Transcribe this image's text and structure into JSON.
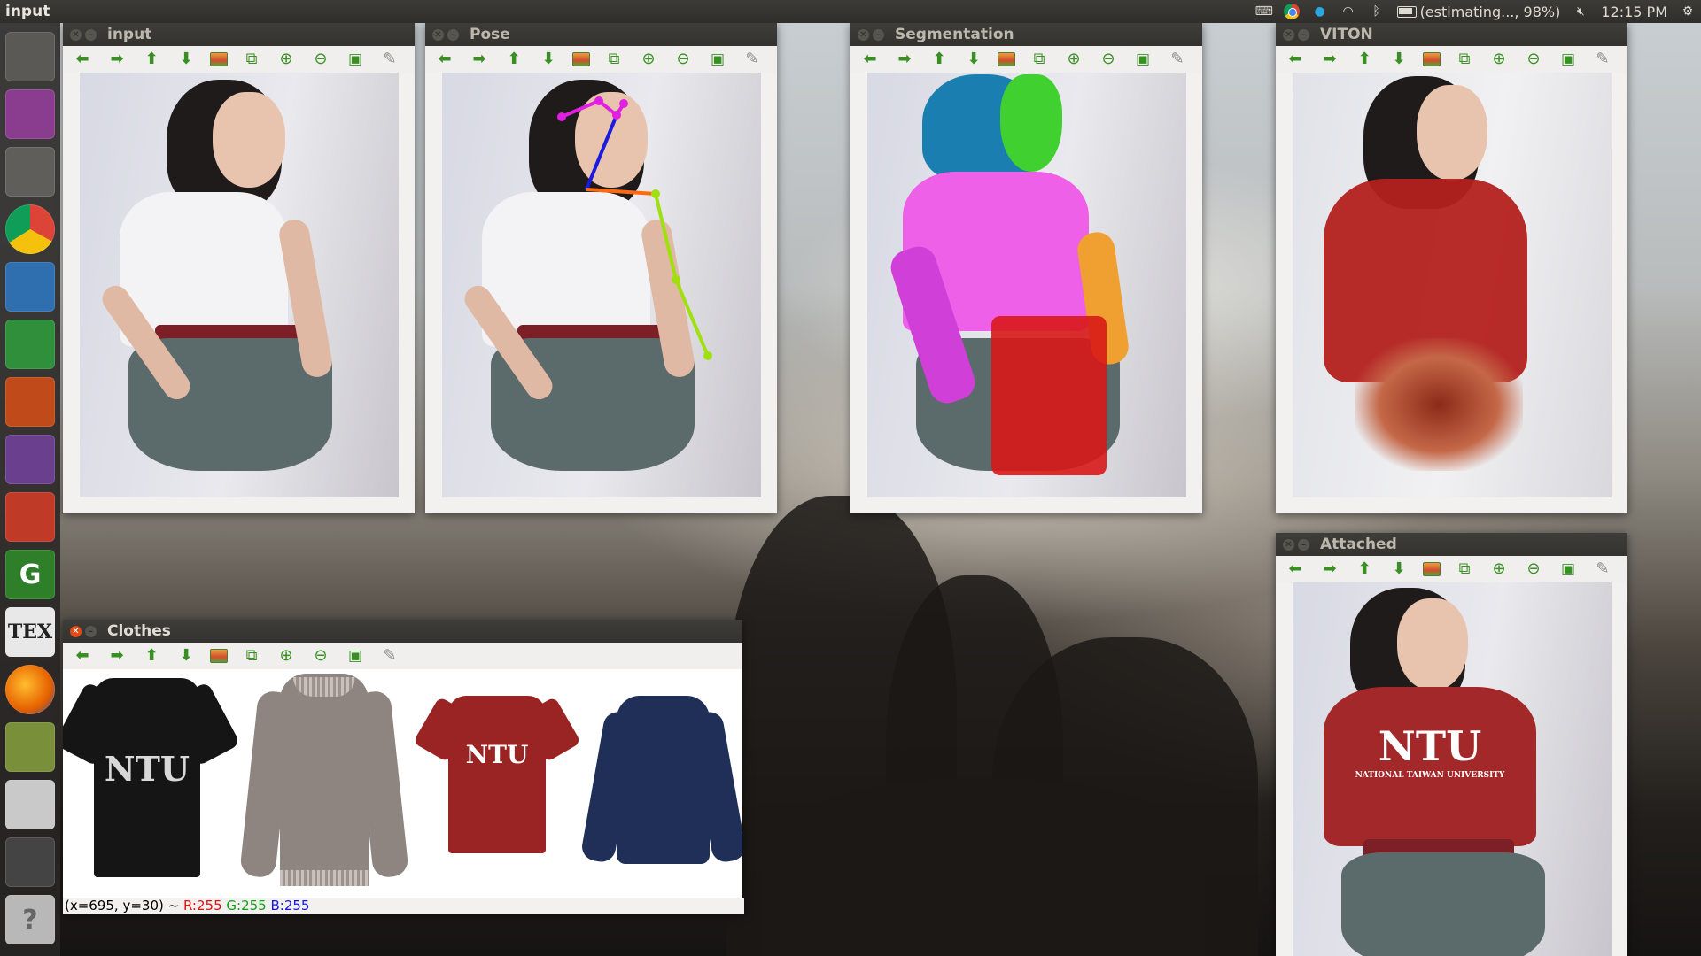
{
  "topbar": {
    "app_title": "input",
    "battery_text": "(estimating..., 98%)",
    "clock": "12:15 PM"
  },
  "launcher": {
    "items": [
      {
        "icon": "ubuntu-dash-icon"
      },
      {
        "icon": "workspace-switcher-icon"
      },
      {
        "icon": "files-icon"
      },
      {
        "icon": "chrome-icon"
      },
      {
        "icon": "libreoffice-writer-icon"
      },
      {
        "icon": "libreoffice-calc-icon"
      },
      {
        "icon": "libreoffice-impress-icon"
      },
      {
        "icon": "webcam-icon"
      },
      {
        "icon": "system-settings-icon"
      },
      {
        "icon": "gedit-icon",
        "glyph": "G"
      },
      {
        "icon": "tex-icon",
        "glyph": "TEX"
      },
      {
        "icon": "firefox-icon"
      },
      {
        "icon": "image-viewer-icon"
      },
      {
        "icon": "drive-icon"
      },
      {
        "icon": "terminal-icon"
      },
      {
        "icon": "help-icon",
        "glyph": "?"
      }
    ]
  },
  "windows": {
    "input": {
      "title": "input"
    },
    "pose": {
      "title": "Pose"
    },
    "segmentation": {
      "title": "Segmentation"
    },
    "viton": {
      "title": "VITON"
    },
    "attached": {
      "title": "Attached",
      "shirt_text": "NTU",
      "shirt_subtext": "NATIONAL TAIWAN UNIVERSITY"
    },
    "clothes": {
      "title": "Clothes",
      "items": [
        {
          "name": "black-ntu-tshirt",
          "text": "NTU",
          "color": "#151515"
        },
        {
          "name": "grey-lace-sweater",
          "text": "",
          "color": "#8e8480"
        },
        {
          "name": "red-ntu-tshirt",
          "text": "NTU",
          "color": "#9a2424"
        },
        {
          "name": "navy-sweatshirt",
          "text": "",
          "color": "#1f2f58"
        }
      ],
      "status": {
        "coords": "(x=695, y=30) ~",
        "r": "R:255",
        "g": "G:255",
        "b": "B:255"
      }
    }
  },
  "colors": {
    "close_button": "#df4a16",
    "toolbar_arrow": "#3a8f24",
    "pose_head": "#e020e0",
    "pose_neck": "#1a1ae0",
    "pose_shoulder": "#ff6a10",
    "pose_arm": "#a0e010",
    "seg_hair": "#1a7fb0",
    "seg_face": "#40d030",
    "seg_top": "#ee60e8",
    "seg_left_arm": "#d040d8",
    "seg_right_arm": "#f0a030",
    "seg_lower": "#d81818"
  }
}
